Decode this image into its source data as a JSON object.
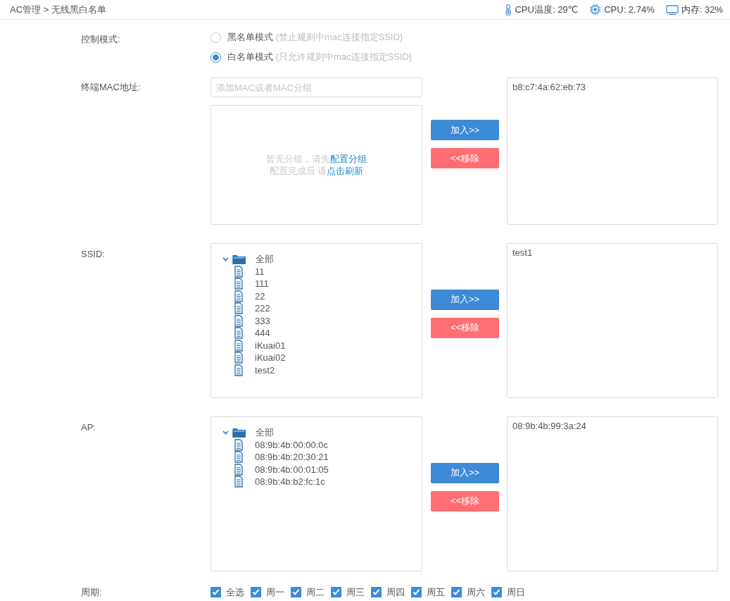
{
  "breadcrumb": "AC管理 > 无线黑白名单",
  "status": [
    {
      "kind": "temperature",
      "text": "CPU温度: 29℃"
    },
    {
      "kind": "cpu",
      "text": "CPU: 2.74%"
    },
    {
      "kind": "memory",
      "text": "内存: 32%"
    }
  ],
  "control_mode": {
    "label": "控制模式:",
    "options": [
      {
        "label": "黑名单模式",
        "hint": "(禁止规则中mac连接指定SSID)",
        "selected": false
      },
      {
        "label": "白名单模式",
        "hint": "(只允许规则中mac连接指定SSID)",
        "selected": true
      }
    ]
  },
  "sections": [
    {
      "kind": "mac",
      "label": "终端MAC地址:",
      "placeholder": "添加MAC或者MAC分组",
      "empty_lines": [
        {
          "text": "暂无分组，请先",
          "link": "配置分组"
        },
        {
          "text": "配置完成后 请",
          "link": "点击刷新"
        }
      ],
      "add_button": "加入>>",
      "remove_button": "<<移除",
      "selected_items": [
        "b8:c7:4a:62:eb:73"
      ]
    },
    {
      "kind": "tree",
      "label": "SSID:",
      "tree": {
        "label": "全部",
        "expanded": true,
        "children": [
          {
            "label": "11"
          },
          {
            "label": "111"
          },
          {
            "label": "22"
          },
          {
            "label": "222"
          },
          {
            "label": "333"
          },
          {
            "label": "444"
          },
          {
            "label": "iKuai01"
          },
          {
            "label": "iKuai02"
          },
          {
            "label": "test2"
          }
        ]
      },
      "add_button": "加入>>",
      "remove_button": "<<移除",
      "selected_items": [
        "test1"
      ]
    },
    {
      "kind": "tree",
      "label": "AP:",
      "tree": {
        "label": "全部",
        "expanded": true,
        "children": [
          {
            "label": "08:9b:4b:00:00:0c"
          },
          {
            "label": "08:9b:4b:20:30:21"
          },
          {
            "label": "08:9b:4b:00:01:05"
          },
          {
            "label": "08:9b:4b:b2:fc:1c"
          }
        ]
      },
      "add_button": "加入>>",
      "remove_button": "<<移除",
      "selected_items": [
        "08:9b:4b:99:3a:24"
      ]
    }
  ],
  "period": {
    "label": "周期:",
    "days": [
      {
        "label": "全选",
        "checked": true
      },
      {
        "label": "周一",
        "checked": true
      },
      {
        "label": "周二",
        "checked": true
      },
      {
        "label": "周三",
        "checked": true
      },
      {
        "label": "周四",
        "checked": true
      },
      {
        "label": "周五",
        "checked": true
      },
      {
        "label": "周六",
        "checked": true
      },
      {
        "label": "周日",
        "checked": true
      }
    ]
  }
}
